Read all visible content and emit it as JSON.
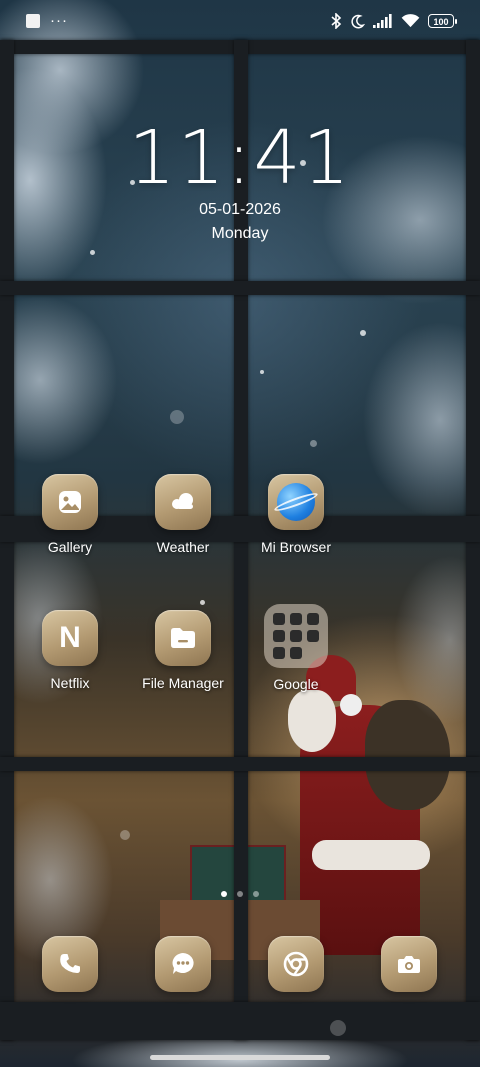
{
  "status_bar": {
    "notification_dots": "···",
    "battery": "100",
    "icons": [
      "notification-square-icon",
      "bluetooth-icon",
      "moon-icon",
      "signal-icon",
      "wifi-icon",
      "battery-icon"
    ]
  },
  "lockclock": {
    "time": "11:41",
    "date": "05-01-2026",
    "weekday": "Monday"
  },
  "apps": {
    "row1": [
      {
        "label": "Gallery",
        "icon": "gallery-icon"
      },
      {
        "label": "Weather",
        "icon": "cloud-icon"
      },
      {
        "label": "Mi Browser",
        "icon": "browser-planet-icon"
      }
    ],
    "row2": [
      {
        "label": "Netflix",
        "icon": "netflix-n-icon"
      },
      {
        "label": "File Manager",
        "icon": "folder-icon"
      },
      {
        "label": "Google",
        "icon": "app-folder-icon"
      }
    ],
    "netflix_letter": "N"
  },
  "dock": [
    {
      "icon": "phone-icon"
    },
    {
      "icon": "messages-icon"
    },
    {
      "icon": "chrome-icon"
    },
    {
      "icon": "camera-icon"
    }
  ],
  "pager": {
    "pages": 3,
    "active": 0
  },
  "colors": {
    "icon_gold": "#b39a72",
    "browser_blue": "#1e7fe0"
  }
}
